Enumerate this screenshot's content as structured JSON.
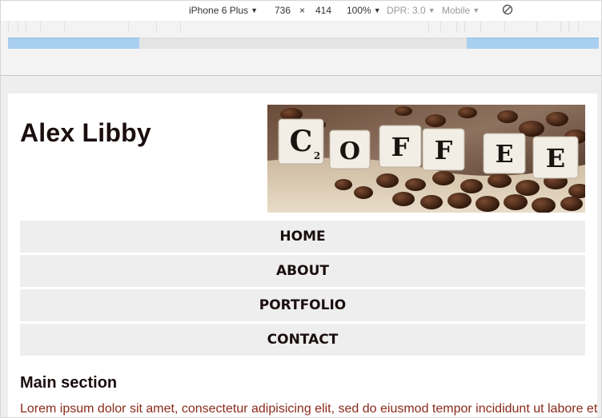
{
  "devtools": {
    "device": "iPhone 6 Plus",
    "width": "736",
    "times": "×",
    "height": "414",
    "zoom": "100%",
    "dpr": "DPR: 3.0",
    "mode": "Mobile",
    "dropdown_arrow": "▼",
    "rotate_icon": "no-touch-icon"
  },
  "media_query_bars": {
    "color": "#a9cfef",
    "track_color": "#e4e4e4"
  },
  "site": {
    "title": "Alex Libby",
    "hero_tiles": [
      "C",
      "2",
      "O",
      "F",
      "F",
      "E",
      "E"
    ],
    "nav": {
      "items": [
        {
          "label": "HOME"
        },
        {
          "label": "ABOUT"
        },
        {
          "label": "PORTFOLIO"
        },
        {
          "label": "CONTACT"
        }
      ]
    },
    "main": {
      "title": "Main section",
      "text": "Lorem ipsum dolor sit amet, consectetur adipisicing elit, sed do eiusmod tempor incididunt ut labore et"
    },
    "colors": {
      "heading": "#1b0e0e",
      "body_text": "#8b2a1a",
      "nav_bg": "#eeeeee"
    }
  }
}
